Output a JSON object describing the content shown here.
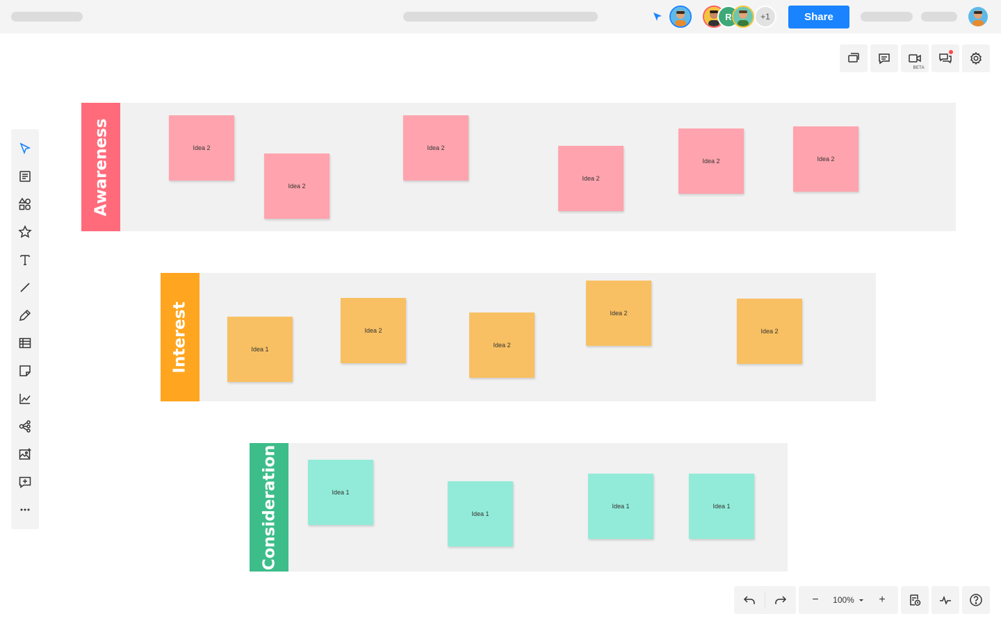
{
  "header": {
    "share_label": "Share",
    "collaborators": [
      {
        "type": "photo"
      },
      {
        "type": "letter",
        "letter": "R"
      },
      {
        "type": "photo"
      }
    ],
    "more_collaborators": "+1"
  },
  "right_toolbar": {
    "buttons": [
      "pages-icon",
      "comments-icon",
      "video-icon",
      "chat-icon",
      "settings-icon"
    ],
    "video_badge": "BETA"
  },
  "left_toolbar": {
    "tools": [
      "select-icon",
      "template-icon",
      "shapes-icon",
      "star-icon",
      "text-icon",
      "line-icon",
      "pen-icon",
      "table-icon",
      "sticky-note-icon",
      "chart-icon",
      "mind-map-icon",
      "image-icon",
      "comment-add-icon",
      "more-icon"
    ]
  },
  "lanes": [
    {
      "label": "Awareness",
      "color": "#ff6b7b",
      "note_color": "#ffa4ae",
      "notes": [
        "Idea 2",
        "Idea 2",
        "Idea 2",
        "Idea 2",
        "Idea 2",
        "Idea 2"
      ]
    },
    {
      "label": "Interest",
      "color": "#ffa51f",
      "note_color": "#f8c062",
      "notes": [
        "Idea 1",
        "Idea 2",
        "Idea 2",
        "Idea 2",
        "Idea 2"
      ]
    },
    {
      "label": "Consideration",
      "color": "#3dbd8a",
      "note_color": "#92ebd8",
      "notes": [
        "Idea 1",
        "Idea 1",
        "Idea 1",
        "Idea 1"
      ]
    }
  ],
  "bottom_toolbar": {
    "zoom": "100%",
    "zoom_out": "−",
    "zoom_in": "+"
  }
}
